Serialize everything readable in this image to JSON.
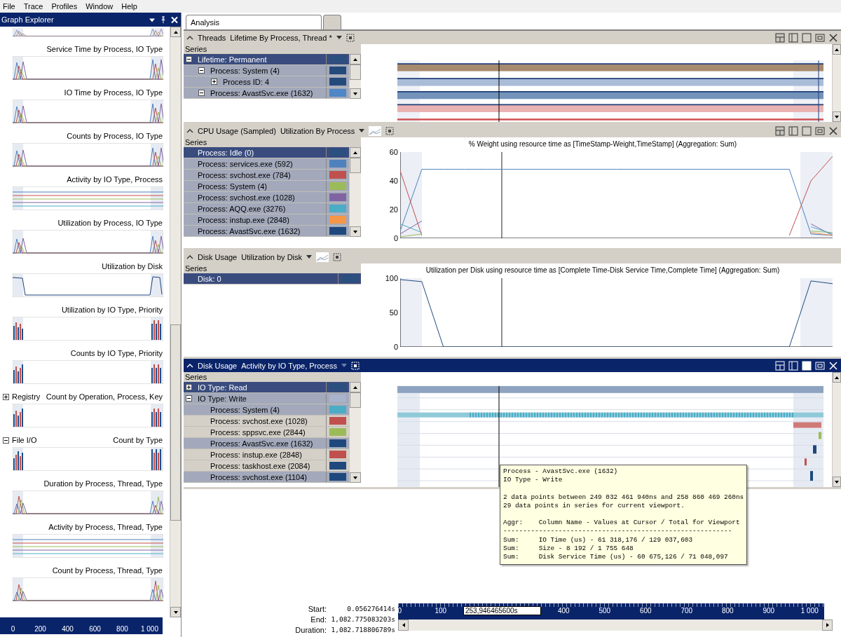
{
  "menu": [
    "File",
    "Trace",
    "Profiles",
    "Window",
    "Help"
  ],
  "graph_explorer": {
    "title": "Graph Explorer",
    "graphs": [
      {
        "kind": "line"
      },
      {
        "title": "Service Time by Process, IO Type",
        "kind": "line"
      },
      {
        "title": "IO Time by Process, IO Type",
        "kind": "line"
      },
      {
        "title": "Counts by Process, IO Type",
        "kind": "line"
      },
      {
        "title": "Activity by IO Type, Process",
        "kind": "activity"
      },
      {
        "title": "Utilization by Process, IO Type",
        "kind": "line"
      },
      {
        "title": "Utilization by Disk",
        "kind": "plateau"
      },
      {
        "title": "Utilization by IO Type, Priority",
        "kind": "bar"
      },
      {
        "title": "Counts by IO Type, Priority",
        "kind": "bar"
      },
      {
        "group": {
          "label": "Registry",
          "expanded": false
        },
        "title": "Count by Operation, Process, Key",
        "kind": "bar"
      },
      {
        "group": {
          "label": "File I/O",
          "expanded": true
        },
        "title": "Count by Type",
        "kind": "bar"
      },
      {
        "title": "Duration by Process, Thread, Type",
        "kind": "line"
      },
      {
        "title": "Activity by Process, Thread, Type",
        "kind": "activity"
      },
      {
        "title": "Count by Process, Thread, Type",
        "kind": "line"
      }
    ],
    "axis_ticks": [
      "0",
      "200",
      "400",
      "600",
      "800",
      "1 000"
    ]
  },
  "tabs": [
    {
      "label": "Analysis",
      "selected": true
    },
    {
      "selected": false
    }
  ],
  "panels": [
    {
      "category": "Threads",
      "preset": "Lifetime By Process, Thread *",
      "active": false,
      "window_controls": true,
      "chart_type_button": false,
      "series_label": "Series",
      "kind": "lifetime",
      "series": [
        {
          "label": "Lifetime: Permanent",
          "color": "#2b4f7f",
          "selected": true,
          "focused": true,
          "expanded": true,
          "children": [
            {
              "label": "Process: System (4)",
              "color": "#244a7c",
              "selected": true,
              "focused": false,
              "expanded": true,
              "children": [
                {
                  "label": "Process ID: 4",
                  "color": "#244a7c",
                  "selected": true,
                  "focused": false,
                  "expanded": false
                }
              ]
            },
            {
              "label": "Process: AvastSvc.exe (1632)",
              "color": "#4f86c6",
              "selected": true,
              "focused": false,
              "expanded": true
            }
          ]
        }
      ]
    },
    {
      "category": "CPU Usage (Sampled)",
      "preset": "Utilization By Process",
      "active": false,
      "window_controls": true,
      "chart_type_button": true,
      "series_label": "Series",
      "kind": "line",
      "series": [
        {
          "label": "Process: Idle (0)",
          "color": "#2b4f7f",
          "selected": true,
          "focused": true
        },
        {
          "label": "Process: services.exe (592)",
          "color": "#4f81bd",
          "selected": true,
          "focused": false
        },
        {
          "label": "Process: svchost.exe (784)",
          "color": "#c0504d",
          "selected": true,
          "focused": false
        },
        {
          "label": "Process: System (4)",
          "color": "#9bbb59",
          "selected": true,
          "focused": false
        },
        {
          "label": "Process: svchost.exe (1028)",
          "color": "#8064a2",
          "selected": true,
          "focused": false
        },
        {
          "label": "Process: AQQ.exe (3276)",
          "color": "#4bacc6",
          "selected": true,
          "focused": false
        },
        {
          "label": "Process: instup.exe (2848)",
          "color": "#f79646",
          "selected": true,
          "focused": false
        },
        {
          "label": "Process: AvastSvc.exe (1632)",
          "color": "#1f497d",
          "selected": true,
          "focused": false
        }
      ],
      "chart_data": {
        "type": "line",
        "title": "% Weight using resource time as [TimeStamp-Weight,TimeStamp] (Aggregation: Sum)",
        "ylim": [
          0,
          60
        ],
        "yticks": [
          0,
          20,
          40,
          60
        ],
        "series": [
          {
            "color": "#4f81bd",
            "values": [
              5,
              48,
              48,
              48,
              48,
              48,
              48,
              48,
              48,
              48,
              48,
              48,
              48,
              48,
              48,
              48,
              48,
              48,
              48,
              3,
              2
            ]
          },
          {
            "color": "#c0504d",
            "values": [
              47,
              2,
              null,
              null,
              null,
              null,
              null,
              null,
              null,
              null,
              null,
              null,
              null,
              null,
              null,
              null,
              null,
              null,
              2,
              40,
              57
            ]
          },
          {
            "color": "#9bbb59",
            "values": [
              1,
              3,
              null,
              null,
              null,
              null,
              null,
              null,
              null,
              null,
              null,
              null,
              null,
              null,
              null,
              null,
              null,
              null,
              null,
              5,
              4
            ]
          },
          {
            "color": "#8064a2",
            "values": [
              3,
              12,
              null,
              null,
              null,
              null,
              null,
              null,
              null,
              null,
              null,
              null,
              null,
              null,
              null,
              null,
              null,
              null,
              null,
              10,
              2
            ]
          },
          {
            "color": "#4bacc6",
            "values": [
              10,
              4,
              null,
              null,
              null,
              null,
              null,
              null,
              null,
              null,
              null,
              null,
              null,
              null,
              null,
              null,
              null,
              null,
              null,
              8,
              3
            ]
          },
          {
            "color": "#f79646",
            "values": [
              null,
              null,
              null,
              null,
              null,
              null,
              null,
              null,
              null,
              null,
              null,
              null,
              null,
              null,
              null,
              null,
              null,
              null,
              null,
              4,
              2
            ]
          }
        ]
      }
    },
    {
      "category": "Disk Usage",
      "preset": "Utilization by Disk",
      "active": false,
      "window_controls": false,
      "chart_type_button": true,
      "series_label": "Series",
      "kind": "line",
      "series": [
        {
          "label": "Disk: 0",
          "color": "#2b4f7f",
          "selected": true,
          "focused": true
        }
      ],
      "chart_data": {
        "type": "line",
        "title": "Utilization per Disk using resource time as [Complete Time-Disk Service Time,Complete Time] (Aggregation: Sum)",
        "ylim": [
          0,
          100
        ],
        "yticks": [
          0,
          50,
          100
        ],
        "series": [
          {
            "color": "#1f497d",
            "values": [
              98,
              95,
              0,
              0,
              0,
              0,
              0,
              0,
              0,
              0,
              0,
              0,
              0,
              0,
              0,
              0,
              0,
              0,
              0,
              96,
              92
            ]
          }
        ]
      }
    },
    {
      "category": "Disk Usage",
      "preset": "Activity by IO Type, Process",
      "active": true,
      "window_controls": true,
      "chart_type_button": false,
      "series_label": "Series",
      "kind": "activity",
      "series": [
        {
          "label": "IO Type: Read",
          "color": "#2b4f7f",
          "selected": true,
          "focused": true,
          "expanded": false
        },
        {
          "label": "IO Type: Write",
          "color": "#a9b3c9",
          "selected": true,
          "focused": false,
          "expanded": true,
          "children": [
            {
              "label": "Process: System (4)",
              "color": "#4bacc6",
              "selected": true,
              "focused": false
            },
            {
              "label": "Process: svchost.exe (1028)",
              "color": "#c0504d",
              "selected": false,
              "focused": false
            },
            {
              "label": "Process: sppsvc.exe (2844)",
              "color": "#9bbb59",
              "selected": false,
              "focused": false
            },
            {
              "label": "Process: AvastSvc.exe (1632)",
              "color": "#1f497d",
              "selected": true,
              "focused": false
            },
            {
              "label": "Process: instup.exe (2848)",
              "color": "#c0504d",
              "selected": false,
              "focused": false
            },
            {
              "label": "Process: taskhost.exe (2084)",
              "color": "#1f497d",
              "selected": false,
              "focused": false
            },
            {
              "label": "Process: svchost.exe (1104)",
              "color": "#1f497d",
              "selected": true,
              "focused": false
            }
          ]
        }
      ]
    }
  ],
  "tooltip": {
    "paragraphs": [
      [
        "Process - AvastSvc.exe (1632)",
        "IO Type - Write"
      ],
      [
        "2 data points between 249 032 461 940ns and 258 860 469 260ns",
        "29 data points in series for current viewport."
      ],
      [
        "Aggr:    Column Name - Values at Cursor / Total for Viewport",
        "----------------------------------------------------------",
        "Sum:     IO Time (us) - 61 318,176 / 129 037,603",
        "Sum:     Size - 8 192 / 1 755 648",
        "Sum:     Disk Service Time (us) - 60 675,126 / 71 048,097"
      ]
    ]
  },
  "timeline": {
    "start_label": "Start:",
    "start": "0.056276414s",
    "end_label": "End:",
    "end": "1,082.775083203s",
    "duration_label": "Duration:",
    "duration": "1,082.718806789s",
    "ticks_before": [
      "0",
      "100"
    ],
    "cursor": "253,946465600s",
    "ticks_after": [
      "400",
      "500",
      "600",
      "700",
      "800",
      "900",
      "1 000"
    ]
  }
}
